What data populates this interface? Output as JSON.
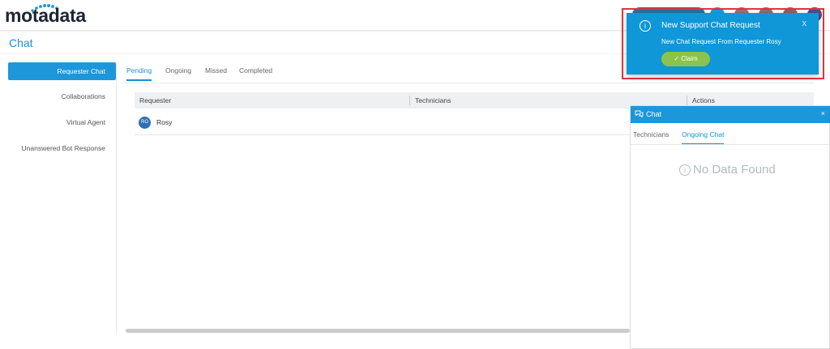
{
  "app": {
    "logo_text": "motadata"
  },
  "page": {
    "title": "Chat"
  },
  "sidebar": {
    "items": [
      {
        "label": "Requester Chat",
        "active": true
      },
      {
        "label": "Collaborations"
      },
      {
        "label": "Virtual Agent"
      },
      {
        "label": "Unanswered Bot Response"
      }
    ]
  },
  "tabs": [
    {
      "label": "Pending",
      "active": true
    },
    {
      "label": "Ongoing"
    },
    {
      "label": "Missed"
    },
    {
      "label": "Completed"
    }
  ],
  "table": {
    "columns": [
      "Requester",
      "Technicians",
      "Actions"
    ],
    "rows": [
      {
        "initials": "RO",
        "requester": "Rosy",
        "technicians": ""
      }
    ]
  },
  "chat_panel": {
    "title": "Chat",
    "close": "×",
    "tabs": [
      {
        "label": "Technicians"
      },
      {
        "label": "Ongoing Chat",
        "active": true
      }
    ],
    "empty_text": "No Data Found"
  },
  "notification": {
    "title": "New Support Chat Request",
    "close": "X",
    "message": "New Chat Request From Requester Rosy",
    "claim_label": "Claim"
  },
  "icons": {
    "info": "info-circle-icon",
    "chat": "chat-bubbles-icon",
    "check": "check-icon"
  },
  "colors": {
    "accent": "#1c97da",
    "toast": "#0f97d8",
    "claim": "#8cc34a",
    "highlight": "#e0353d",
    "avatar": "#2f6fb5"
  }
}
